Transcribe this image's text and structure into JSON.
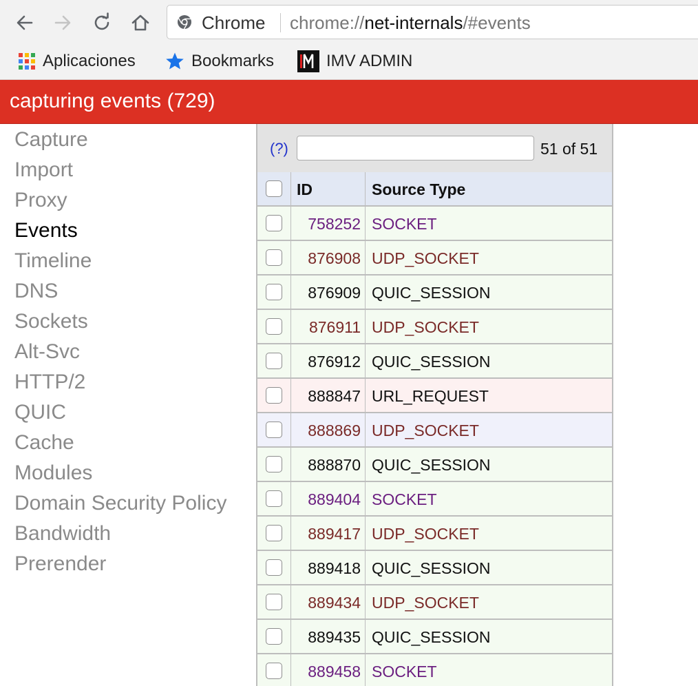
{
  "browser": {
    "site_label": "Chrome",
    "url_scheme": "chrome://",
    "url_host": "net-internals",
    "url_path": "/#events"
  },
  "bookmarks": [
    {
      "label": "Aplicaciones",
      "icon": "apps-grid-icon"
    },
    {
      "label": "Bookmarks",
      "icon": "star-icon"
    },
    {
      "label": "IMV ADMIN",
      "icon": "imv-logo-icon"
    }
  ],
  "status": {
    "text": "capturing events (729)",
    "color": "#dc3023"
  },
  "sidebar": {
    "active": "Events",
    "items": [
      {
        "label": "Capture"
      },
      {
        "label": "Import"
      },
      {
        "label": "Proxy"
      },
      {
        "label": "Events"
      },
      {
        "label": "Timeline"
      },
      {
        "label": "DNS"
      },
      {
        "label": "Sockets"
      },
      {
        "label": "Alt-Svc"
      },
      {
        "label": "HTTP/2"
      },
      {
        "label": "QUIC"
      },
      {
        "label": "Cache"
      },
      {
        "label": "Modules"
      },
      {
        "label": "Domain Security Policy"
      },
      {
        "label": "Bandwidth"
      },
      {
        "label": "Prerender"
      }
    ]
  },
  "events": {
    "help_label": "(?)",
    "filter_value": "",
    "count_text": "51 of 51",
    "columns": {
      "id": "ID",
      "source_type": "Source Type"
    },
    "rows": [
      {
        "id": "758252",
        "type": "SOCKET",
        "color": "#6b1f80",
        "bg": "#f4fbf1"
      },
      {
        "id": "876908",
        "type": "UDP_SOCKET",
        "color": "#7a2a28",
        "bg": "#f4fbf1"
      },
      {
        "id": "876909",
        "type": "QUIC_SESSION",
        "color": "#111111",
        "bg": "#f4fbf1"
      },
      {
        "id": "876911",
        "type": "UDP_SOCKET",
        "color": "#7a2a28",
        "bg": "#f4fbf1"
      },
      {
        "id": "876912",
        "type": "QUIC_SESSION",
        "color": "#111111",
        "bg": "#f4fbf1"
      },
      {
        "id": "888847",
        "type": "URL_REQUEST",
        "color": "#111111",
        "bg": "#fdf1f1"
      },
      {
        "id": "888869",
        "type": "UDP_SOCKET",
        "color": "#7a2a28",
        "bg": "#f0f1fb"
      },
      {
        "id": "888870",
        "type": "QUIC_SESSION",
        "color": "#111111",
        "bg": "#f4fbf1"
      },
      {
        "id": "889404",
        "type": "SOCKET",
        "color": "#6b1f80",
        "bg": "#f4fbf1"
      },
      {
        "id": "889417",
        "type": "UDP_SOCKET",
        "color": "#7a2a28",
        "bg": "#f4fbf1"
      },
      {
        "id": "889418",
        "type": "QUIC_SESSION",
        "color": "#111111",
        "bg": "#f4fbf1"
      },
      {
        "id": "889434",
        "type": "UDP_SOCKET",
        "color": "#7a2a28",
        "bg": "#f4fbf1"
      },
      {
        "id": "889435",
        "type": "QUIC_SESSION",
        "color": "#111111",
        "bg": "#f4fbf1"
      },
      {
        "id": "889458",
        "type": "SOCKET",
        "color": "#6b1f80",
        "bg": "#f4fbf1"
      }
    ]
  }
}
